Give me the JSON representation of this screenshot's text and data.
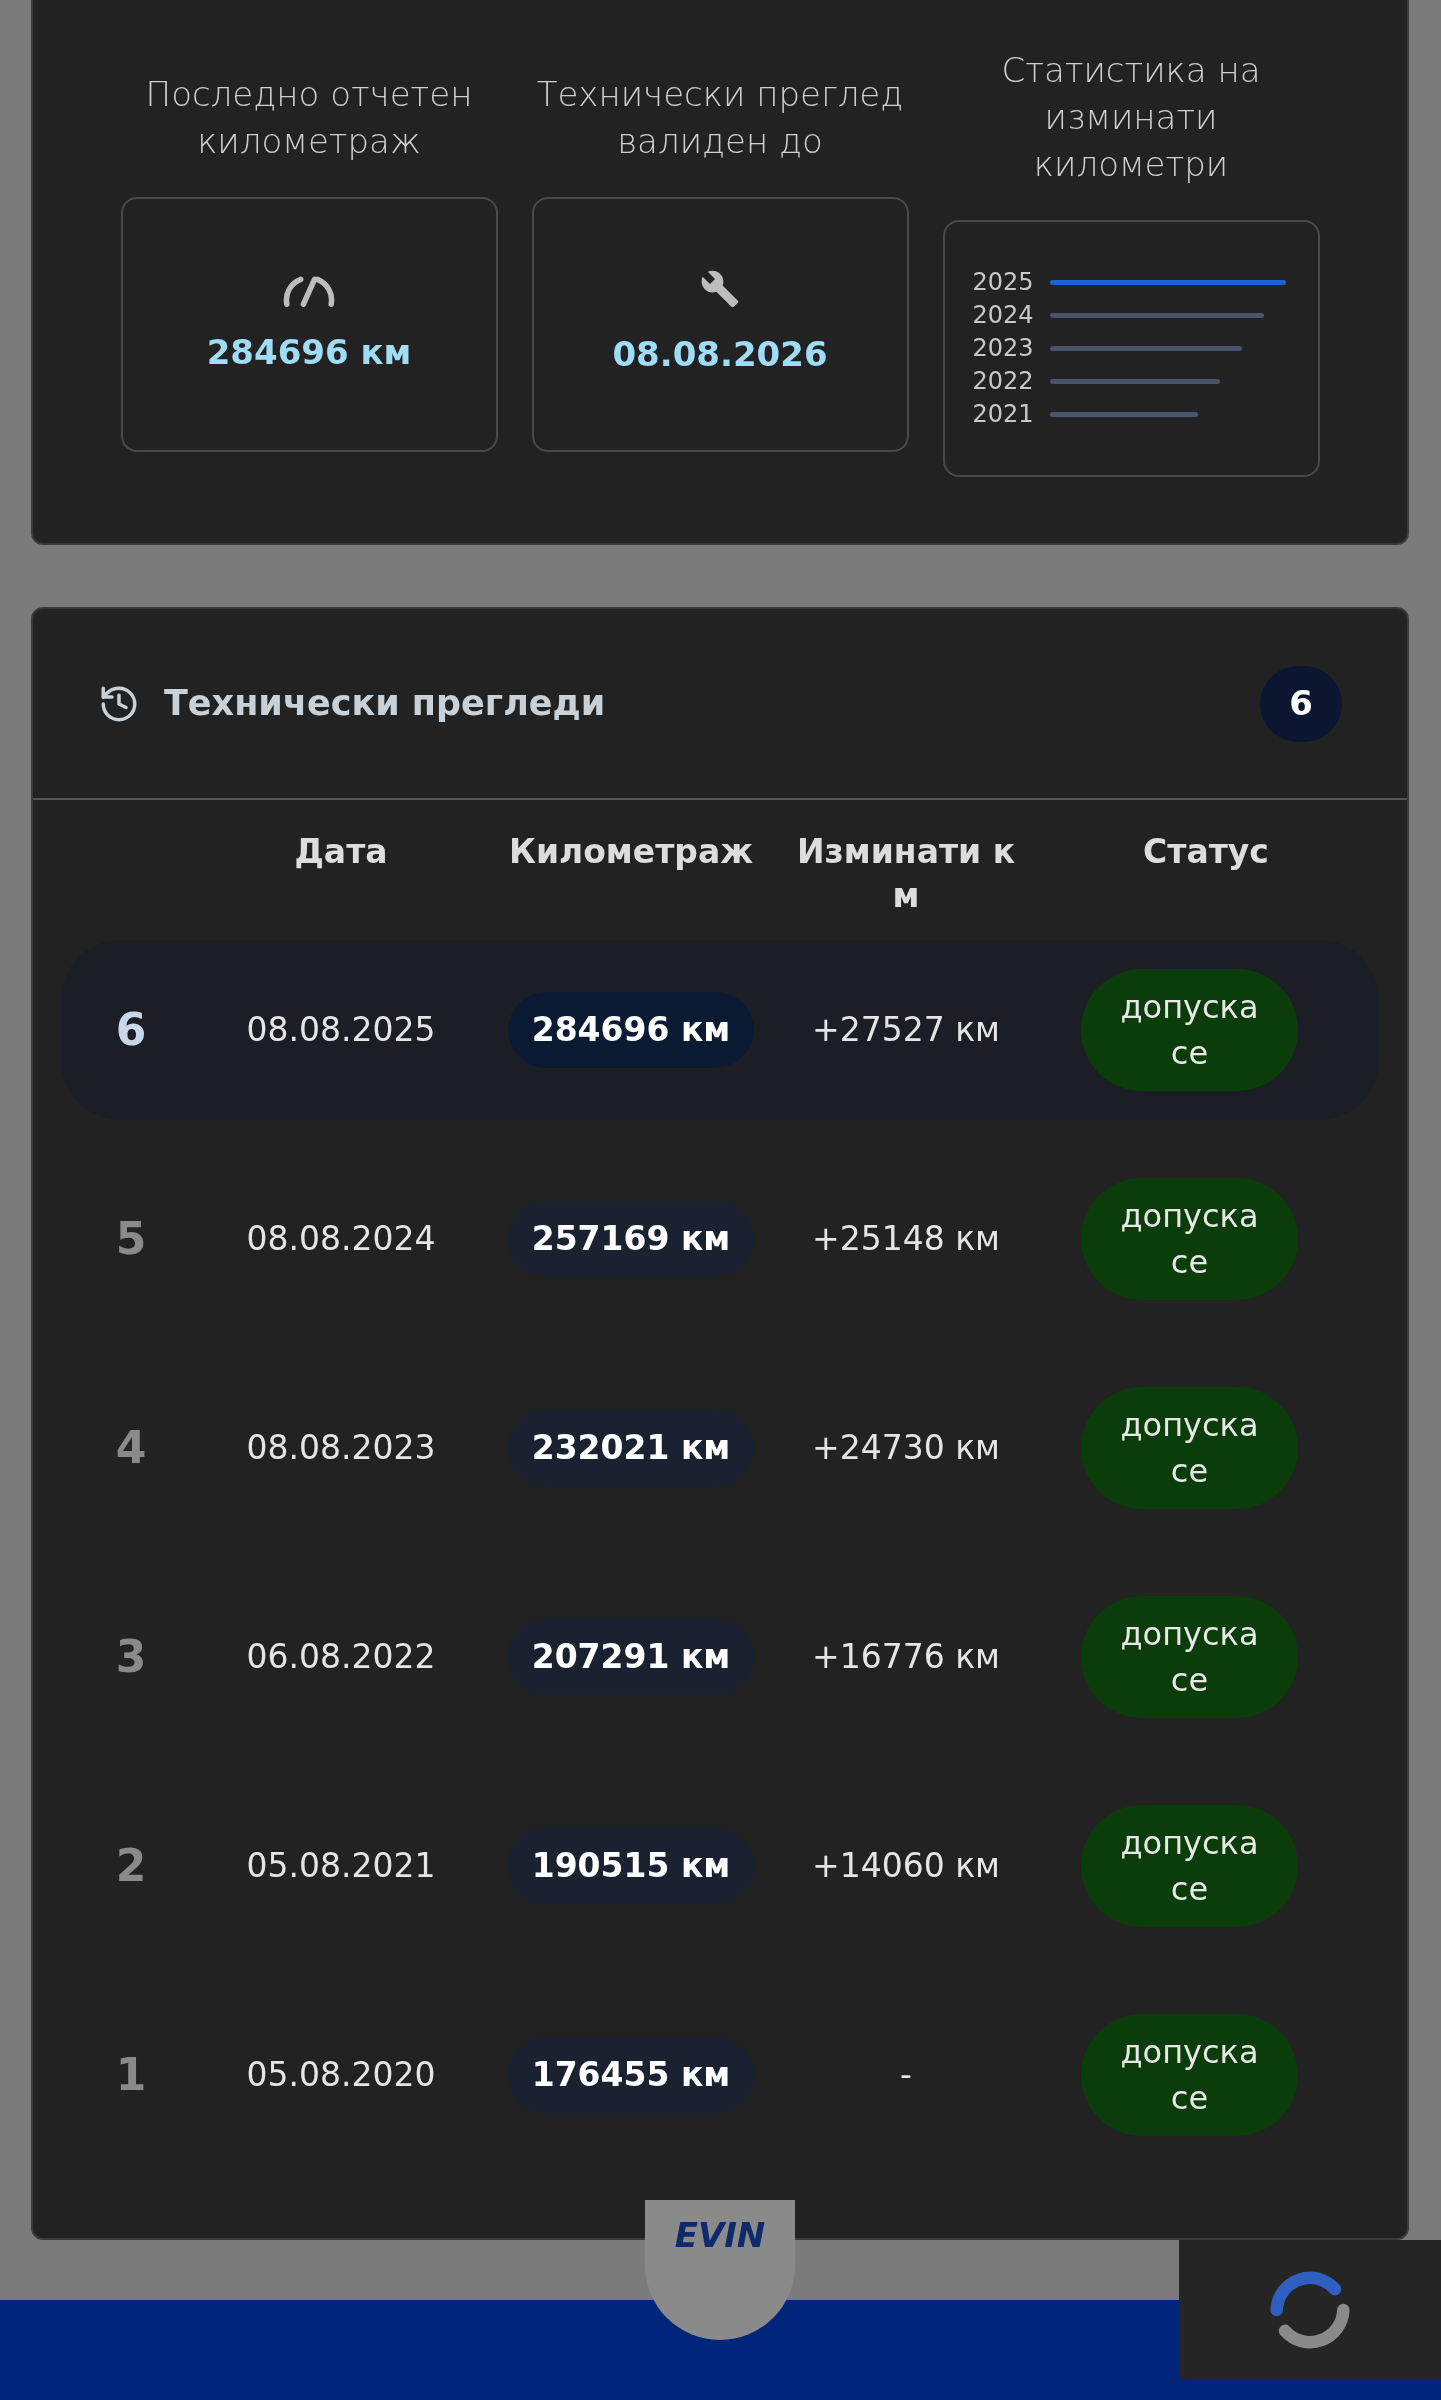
{
  "summary": [
    {
      "kind": "odometer",
      "label": "Последно отчетен километраж",
      "value": "284696 км"
    },
    {
      "kind": "inspection",
      "label": "Технически преглед валиден до",
      "value": "08.08.2026"
    },
    {
      "kind": "stats",
      "label": "Статистика на изминати километри",
      "years": [
        {
          "label": "2025",
          "highlighted": true
        },
        {
          "label": "2024",
          "highlighted": false
        },
        {
          "label": "2023",
          "highlighted": false
        },
        {
          "label": "2022",
          "highlighted": false
        },
        {
          "label": "2021",
          "highlighted": false
        }
      ]
    }
  ],
  "inspections": {
    "title": "Технически прегледи",
    "count": "6",
    "columns": [
      "Дата",
      "Километраж",
      "Изминати км",
      "Статус"
    ],
    "rows": [
      {
        "number": "6",
        "date": "08.08.2025",
        "mileage": "284696 км",
        "driven": "+27527 км",
        "status": "допуска се",
        "highlighted": true
      },
      {
        "number": "5",
        "date": "08.08.2024",
        "mileage": "257169 км",
        "driven": "+25148 км",
        "status": "допуска се",
        "highlighted": false
      },
      {
        "number": "4",
        "date": "08.08.2023",
        "mileage": "232021 км",
        "driven": "+24730 км",
        "status": "допуска се",
        "highlighted": false
      },
      {
        "number": "3",
        "date": "06.08.2022",
        "mileage": "207291 км",
        "driven": "+16776 км",
        "status": "допуска се",
        "highlighted": false
      },
      {
        "number": "2",
        "date": "05.08.2021",
        "mileage": "190515 км",
        "driven": "+14060 км",
        "status": "допуска се",
        "highlighted": false
      },
      {
        "number": "1",
        "date": "05.08.2020",
        "mileage": "176455 км",
        "driven": "-",
        "status": "допуска се",
        "highlighted": false
      }
    ]
  },
  "footer": {
    "logo": "EVIN"
  }
}
